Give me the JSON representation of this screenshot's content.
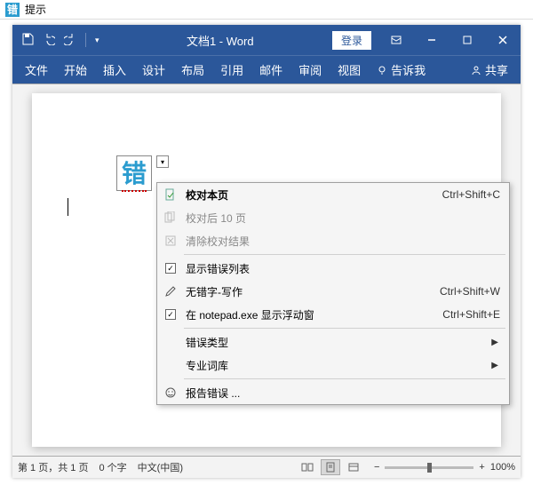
{
  "outer_window": {
    "title": "提示"
  },
  "titlebar": {
    "doc_title": "文档1 - Word",
    "login": "登录"
  },
  "ribbon": {
    "tabs": [
      "文件",
      "开始",
      "插入",
      "设计",
      "布局",
      "引用",
      "邮件",
      "审阅",
      "视图"
    ],
    "tell_me": "告诉我",
    "share": "共享"
  },
  "cuo_word": "错",
  "menu": {
    "items": [
      {
        "label": "校对本页",
        "accel": "Ctrl+Shift+C",
        "icon": "page-check",
        "bold": true
      },
      {
        "label": "校对后 10 页",
        "disabled": true,
        "icon": "pages"
      },
      {
        "label": "清除校对结果",
        "disabled": true,
        "icon": "clear"
      },
      {
        "sep": true
      },
      {
        "label": "显示错误列表",
        "checked": true
      },
      {
        "label": "无错字-写作",
        "accel": "Ctrl+Shift+W",
        "icon": "edit"
      },
      {
        "label": "在 notepad.exe 显示浮动窗",
        "accel": "Ctrl+Shift+E",
        "checked": true
      },
      {
        "sep": true
      },
      {
        "label": "错误类型",
        "submenu": true
      },
      {
        "label": "专业词库",
        "submenu": true
      },
      {
        "sep": true
      },
      {
        "label": "报告错误 ...",
        "icon": "smile"
      }
    ]
  },
  "statusbar": {
    "page": "第 1 页，共 1 页",
    "words": "0 个字",
    "lang": "中文(中国)",
    "zoom_minus": "−",
    "zoom_plus": "+",
    "zoom": "100%"
  }
}
